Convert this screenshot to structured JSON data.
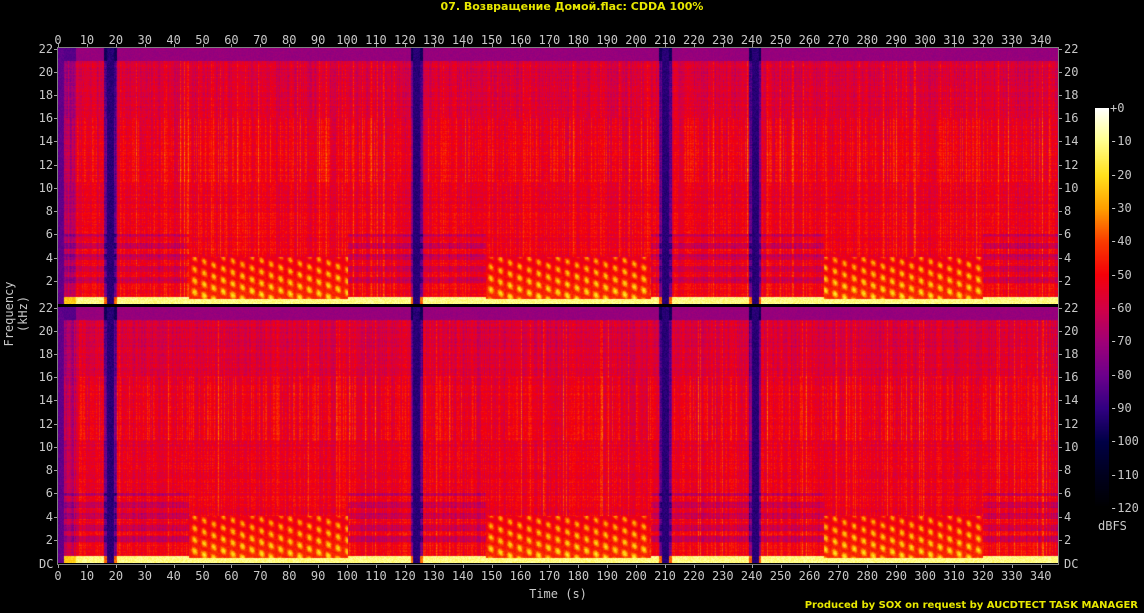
{
  "title": "07. Возвращение Домой.flac: CDDA 100%",
  "footer": "Produced by SOX on request by AUCDTECT TASK MANAGER",
  "chart_data": {
    "type": "heatmap",
    "title": "07. Возвращение Домой.flac: CDDA 100%",
    "xlabel": "Time (s)",
    "ylabel": "Frequency (kHz)",
    "channels": 2,
    "xlim": [
      0,
      346
    ],
    "ylim": [
      0,
      22.05
    ],
    "x_ticks": [
      0,
      10,
      20,
      30,
      40,
      50,
      60,
      70,
      80,
      90,
      100,
      110,
      120,
      130,
      140,
      150,
      160,
      170,
      180,
      190,
      200,
      210,
      220,
      230,
      240,
      250,
      260,
      270,
      280,
      290,
      300,
      310,
      320,
      330,
      340
    ],
    "y_ticks": [
      "22",
      "20",
      "18",
      "16",
      "14",
      "12",
      "10",
      "8",
      "6",
      "4",
      "2"
    ],
    "y_zero_label": "DC",
    "lowpass_cutoff_khz": 21,
    "silent_gaps_s": [
      18,
      124,
      210,
      241
    ],
    "colorbar": {
      "unit": "dBFS",
      "range": [
        -120,
        0
      ],
      "ticks": [
        "+0",
        "-10",
        "-20",
        "-30",
        "-40",
        "-50",
        "-60",
        "-70",
        "-80",
        "-90",
        "-100",
        "-110",
        "-120"
      ]
    }
  }
}
